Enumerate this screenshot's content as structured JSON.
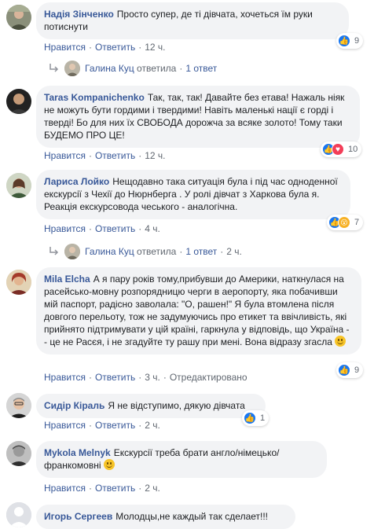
{
  "labels": {
    "like": "Нравится",
    "reply": "Ответить",
    "dot": "·",
    "edited": "Отредактировано",
    "replied": "ответила"
  },
  "comments": [
    {
      "author": "Надія Зінченко",
      "text": "Просто супер, де ті дівчата, хочеться їм руки потиснути",
      "time": "12 ч.",
      "reactions": [
        "like"
      ],
      "reaction_count": "9",
      "replies": {
        "name": "Галина Куц",
        "count_label": "1 ответ",
        "time": ""
      }
    },
    {
      "author": "Taras Kompanichenko",
      "text": "Так, так, так! Давайте без етава! Нажаль ніяк не можуть бути гордими і твердими! Навіть маленькі нації є горді і тверді! Бо для них їх СВОБОДА дорожча за всяке золото! Тому таки БУДЕМО ПРО ЦЕ!",
      "time": "12 ч.",
      "reactions": [
        "like",
        "love"
      ],
      "reaction_count": "10"
    },
    {
      "author": "Лариса Лойко",
      "text": "Нещодавно така ситуація була і під час одноденної екскурсії з Чехії до Нюрнберга . У ролі дівчат з Харкова була я. Реакція екскурсовода чеського - аналогічна.",
      "time": "4 ч.",
      "reactions": [
        "like",
        "wow"
      ],
      "reaction_count": "7",
      "replies": {
        "name": "Галина Куц",
        "count_label": "1 ответ",
        "time": "2 ч."
      }
    },
    {
      "author": "Mila Elcha",
      "text": "А я пару років тому,прибувши до Америки, наткнулася на расейсько-мовну розпорядницю черги в аеропорту, яка побачивши мій паспорт, радісно заволала: \"О, рашен!\" Я була втомлена після довгого перельоту, тож не задумуючись про етикет та ввічливість, які прийнято підтримувати у цій країні, гаркнула у відповідь, що Україна -- це не Расєя, і не згадуйте ту рашу при мені. Вона відразу згасла",
      "time": "3 ч.",
      "edited": true,
      "reactions": [
        "like"
      ],
      "reaction_count": "9"
    },
    {
      "author": "Сидір Кіраль",
      "text": "Я не відступимо, дякую дівчата",
      "time": "2 ч.",
      "reactions": [
        "like"
      ],
      "reaction_count": "1"
    },
    {
      "author": "Mykola Melnyk",
      "text": "Екскурсії треба брати англо/німецько/ франкомовні",
      "time": "2 ч."
    },
    {
      "author": "Игорь Сергеев",
      "text": "Молодцы,не каждый так сделает!!!"
    }
  ],
  "colors": {
    "link": "#385898",
    "bubble": "#f2f3f5",
    "meta": "#606770",
    "like": "#1877f2",
    "love": "#f33e58",
    "wow": "#f7b125"
  }
}
